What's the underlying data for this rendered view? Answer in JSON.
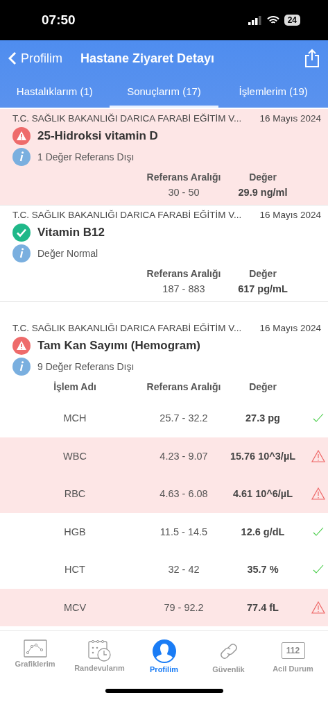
{
  "status_bar": {
    "time": "07:50",
    "battery": "24"
  },
  "nav": {
    "back": "Profilim",
    "title": "Hastane Ziyaret Detayı"
  },
  "tabs": [
    {
      "label": "Hastalıklarım (1)",
      "selected": false
    },
    {
      "label": "Sonuçlarım (17)",
      "selected": true
    },
    {
      "label": "İşlemlerim (19)",
      "selected": false
    }
  ],
  "results": [
    {
      "kind": "single",
      "abnormal": true,
      "hospital": "T.C. SAĞLIK BAKANLIĞI DARICA FARABİ EĞİTİM V...",
      "date": "16 Mayıs 2024",
      "title": "25-Hidroksi vitamin D",
      "info": "1 Değer Referans Dışı",
      "headers": [
        "Referans Aralığı",
        "Değer"
      ],
      "reference": "30 - 50",
      "value": "29.9 ng/ml"
    },
    {
      "kind": "single",
      "abnormal": false,
      "hospital": "T.C. SAĞLIK BAKANLIĞI DARICA FARABİ EĞİTİM V...",
      "date": "16 Mayıs 2024",
      "title": "Vitamin B12",
      "info": "Değer Normal",
      "headers": [
        "Referans Aralığı",
        "Değer"
      ],
      "reference": "187 - 883",
      "value": "617 pg/mL"
    },
    {
      "kind": "table",
      "abnormal": true,
      "hospital": "T.C. SAĞLIK BAKANLIĞI DARICA FARABİ EĞİTİM V...",
      "date": "16 Mayıs 2024",
      "title": "Tam Kan Sayımı (Hemogram)",
      "info": "9 Değer Referans Dışı",
      "headers": [
        "İşlem Adı",
        "Referans Aralığı",
        "Değer"
      ],
      "rows": [
        {
          "name": "MCH",
          "reference": "25.7 - 32.2",
          "value": "27.3 pg",
          "abnormal": false
        },
        {
          "name": "WBC",
          "reference": "4.23 - 9.07",
          "value": "15.76 10^3/µL",
          "abnormal": true
        },
        {
          "name": "RBC",
          "reference": "4.63 - 6.08",
          "value": "4.61 10^6/µL",
          "abnormal": true
        },
        {
          "name": "HGB",
          "reference": "11.5 - 14.5",
          "value": "12.6 g/dL",
          "abnormal": false
        },
        {
          "name": "HCT",
          "reference": "32 - 42",
          "value": "35.7 %",
          "abnormal": false
        },
        {
          "name": "MCV",
          "reference": "79 - 92.2",
          "value": "77.4 fL",
          "abnormal": true
        }
      ]
    }
  ],
  "tab_bar": [
    {
      "label": "Grafiklerim",
      "kind": "chart",
      "selected": false
    },
    {
      "label": "Randevularım",
      "kind": "calendar",
      "selected": false
    },
    {
      "label": "Profilim",
      "kind": "person",
      "selected": true
    },
    {
      "label": "Güvenlik",
      "kind": "link",
      "selected": false
    },
    {
      "label": "Acil Durum",
      "kind": "emergency",
      "icon_text": "112",
      "selected": false
    }
  ]
}
